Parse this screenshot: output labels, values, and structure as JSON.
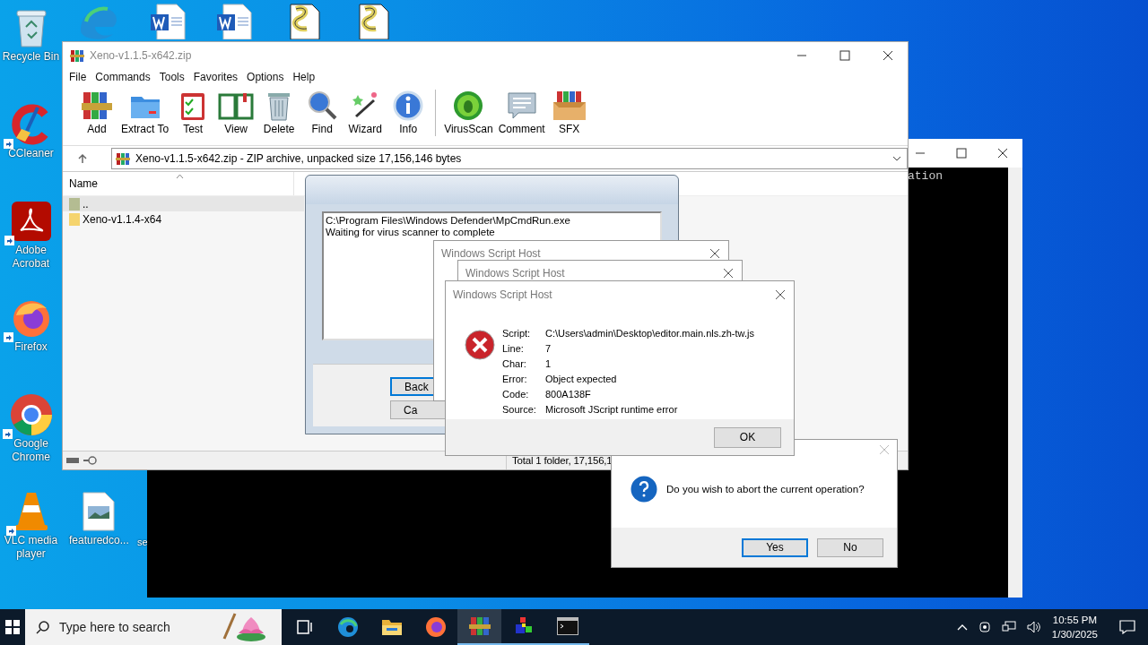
{
  "desktop_icons": [
    {
      "label": "Recycle Bin",
      "kind": "recycle",
      "shortcut": false
    },
    {
      "label": "CCleaner",
      "kind": "ccleaner",
      "shortcut": true
    },
    {
      "label": "Adobe Acrobat",
      "kind": "acrobat",
      "shortcut": true
    },
    {
      "label": "Firefox",
      "kind": "firefox",
      "shortcut": true
    },
    {
      "label": "Google Chrome",
      "kind": "chrome",
      "shortcut": true
    },
    {
      "label": "VLC media player",
      "kind": "vlc",
      "shortcut": true
    },
    {
      "label": "featuredco...",
      "kind": "image",
      "shortcut": false
    },
    {
      "label": "se",
      "kind": "hidden"
    }
  ],
  "top_icons": [
    {
      "kind": "edge"
    },
    {
      "kind": "word"
    },
    {
      "kind": "word"
    },
    {
      "kind": "script"
    },
    {
      "kind": "script"
    }
  ],
  "console": {
    "text": "ation"
  },
  "winrar": {
    "title": "Xeno-v1.1.5-x642.zip",
    "menu": [
      "File",
      "Commands",
      "Tools",
      "Favorites",
      "Options",
      "Help"
    ],
    "toolbar": [
      {
        "label": "Add",
        "kind": "add"
      },
      {
        "label": "Extract To",
        "kind": "extract"
      },
      {
        "label": "Test",
        "kind": "test"
      },
      {
        "label": "View",
        "kind": "view"
      },
      {
        "label": "Delete",
        "kind": "delete"
      },
      {
        "label": "Find",
        "kind": "find"
      },
      {
        "label": "Wizard",
        "kind": "wizard"
      },
      {
        "label": "Info",
        "kind": "info"
      },
      {
        "label": "VirusScan",
        "kind": "virus"
      },
      {
        "label": "Comment",
        "kind": "comment"
      },
      {
        "label": "SFX",
        "kind": "sfx"
      }
    ],
    "address": "Xeno-v1.1.5-x642.zip - ZIP archive, unpacked size 17,156,146 bytes",
    "column": "Name",
    "rows": [
      {
        "name": "..",
        "kind": "parent",
        "selected": true
      },
      {
        "name": "Xeno-v1.1.4-x64",
        "kind": "folder",
        "selected": false
      }
    ],
    "status": "Total 1 folder, 17,156,1"
  },
  "progress_dialog": {
    "lines": [
      "C:\\Program Files\\Windows Defender\\MpCmdRun.exe",
      "Waiting for virus scanner to complete"
    ],
    "buttons": [
      {
        "label": "Back",
        "selected": true
      },
      {
        "label": "Ca",
        "selected": false
      }
    ]
  },
  "script_errors": [
    {
      "title": "Windows Script Host"
    },
    {
      "title": "Windows Script Host"
    },
    {
      "title": "Windows Script Host",
      "fields": [
        {
          "label": "Script:",
          "value": "C:\\Users\\admin\\Desktop\\editor.main.nls.zh-tw.js"
        },
        {
          "label": "Line:",
          "value": "7"
        },
        {
          "label": "Char:",
          "value": "1"
        },
        {
          "label": "Error:",
          "value": "Object expected"
        },
        {
          "label": "Code:",
          "value": "800A138F"
        },
        {
          "label": "Source:",
          "value": "Microsoft JScript runtime error"
        }
      ],
      "button": "OK"
    }
  ],
  "question": {
    "text": "Do you wish to abort the current operation?",
    "buttons": [
      {
        "label": "Yes",
        "selected": true
      },
      {
        "label": "No",
        "selected": false
      }
    ]
  },
  "taskbar": {
    "search": {
      "placeholder": "Type here to search"
    },
    "apps": [
      {
        "kind": "taskview",
        "running": false,
        "selected": false
      },
      {
        "kind": "edge",
        "running": false,
        "selected": false
      },
      {
        "kind": "explorer",
        "running": false,
        "selected": false
      },
      {
        "kind": "firefox",
        "running": false,
        "selected": false
      },
      {
        "kind": "winrar",
        "running": true,
        "selected": true
      },
      {
        "kind": "app",
        "running": true,
        "selected": false
      },
      {
        "kind": "cmd",
        "running": true,
        "selected": false
      }
    ],
    "time": "10:55 PM",
    "date": "1/30/2025"
  }
}
